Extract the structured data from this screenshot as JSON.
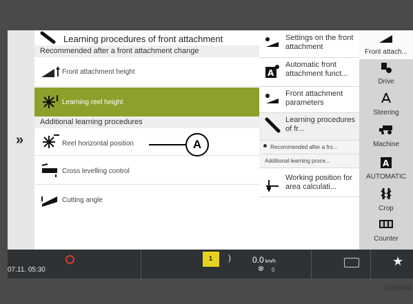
{
  "left_panel": {
    "title": "Learning procedures of front attachment",
    "section1": "Recommended after a front attachment change",
    "section2": "Additional learning procedures",
    "items": [
      {
        "label": "Front attachment height"
      },
      {
        "label": "Learning reel height"
      },
      {
        "label": "Reel horizontal position"
      },
      {
        "label": "Cross levelling control"
      },
      {
        "label": "Cutting angle"
      }
    ],
    "nav_chevron": "»"
  },
  "middle_panel": {
    "items": [
      {
        "label": "Settings on the front attachment"
      },
      {
        "label": "Automatic front attachment funct..."
      },
      {
        "label": "Front attachment parameters"
      },
      {
        "label": "Learning procedures of fr..."
      },
      {
        "label": "Working position for area calculati..."
      }
    ],
    "sub_items": [
      {
        "label": "Recommended after a fro..."
      },
      {
        "label": "Additional learning proce..."
      }
    ]
  },
  "right_tabs": {
    "items": [
      {
        "label": "Front attach..."
      },
      {
        "label": "Drive"
      },
      {
        "label": "Steering"
      },
      {
        "label": "Machine"
      },
      {
        "label": "AUTOMATIC"
      },
      {
        "label": "Crop"
      },
      {
        "label": "Counter"
      }
    ]
  },
  "status_bar": {
    "time": "07.11.  05:30",
    "gear": "1",
    "speed": "0.0",
    "speed_unit": "km/h",
    "rpm": "0"
  },
  "callout": "A",
  "figure_id": "1035464"
}
